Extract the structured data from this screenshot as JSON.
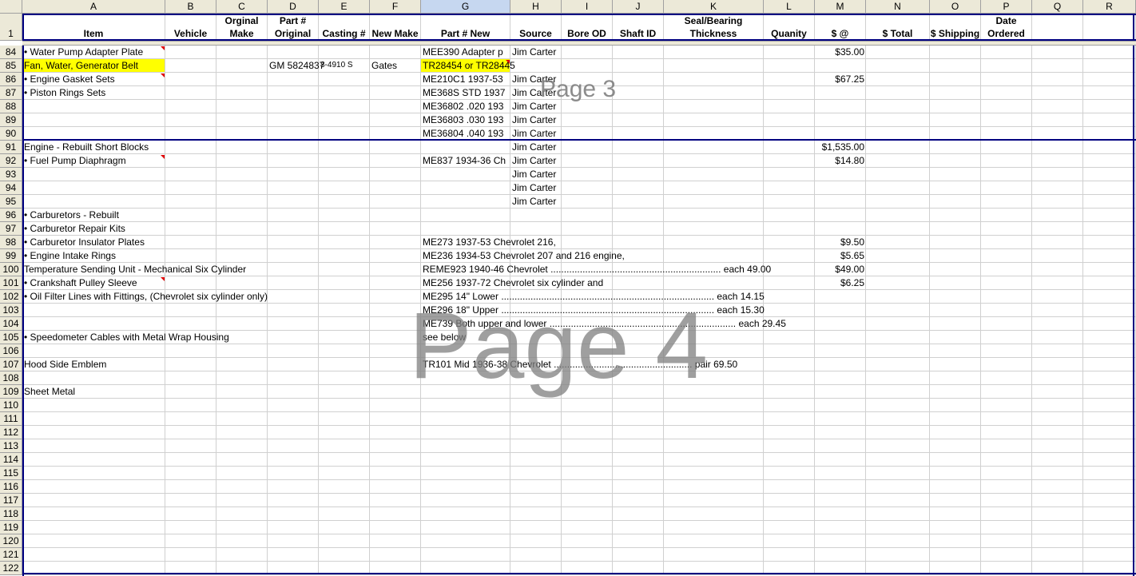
{
  "columns": [
    "A",
    "B",
    "C",
    "D",
    "E",
    "F",
    "G",
    "H",
    "I",
    "J",
    "K",
    "L",
    "M",
    "N",
    "O",
    "P",
    "Q",
    "R"
  ],
  "selected_column": "G",
  "header_row_number": "1",
  "headers": {
    "A": "Item",
    "B": "Vehicle",
    "C": "Orginal Make",
    "D": "Part # Original",
    "E": "Casting #",
    "F": "New Make",
    "G": "Part # New",
    "H": "Source",
    "I": "Bore OD",
    "J": "Shaft ID",
    "K": "Seal/Bearing Thickness",
    "L": "Quanity",
    "M": "$ @",
    "N": "$ Total",
    "O": "$ Shipping",
    "P": "Date Ordered"
  },
  "rows": [
    {
      "n": "84",
      "A": "• Water Pump Adapter Plate",
      "G": "MEE390 Adapter p",
      "H": "Jim Carter",
      "M": "$35.00"
    },
    {
      "n": "85",
      "A": "Fan, Water, Generator Belt",
      "D": "GM 5824837",
      "E": "8-4910 S",
      "F": "Gates",
      "G": "TR28454 or TR28445"
    },
    {
      "n": "86",
      "A": "• Engine Gasket Sets",
      "G": "ME210C1 1937-53",
      "H": "Jim Carter",
      "M": "$67.25"
    },
    {
      "n": "87",
      "A": "• Piston Rings Sets",
      "G": "ME368S STD 1937",
      "H": "Jim Carter"
    },
    {
      "n": "88",
      "G": "ME36802 .020 193",
      "H": "Jim Carter"
    },
    {
      "n": "89",
      "G": "ME36803 .030 193",
      "H": "Jim Carter"
    },
    {
      "n": "90",
      "G": "ME36804 .040 193",
      "H": "Jim Carter"
    },
    {
      "n": "91",
      "A": "Engine - Rebuilt Short Blocks",
      "H": "Jim Carter",
      "M": "$1,535.00"
    },
    {
      "n": "92",
      "A": "• Fuel Pump Diaphragm",
      "G": "ME837 1934-36 Ch",
      "H": "Jim Carter",
      "M": "$14.80"
    },
    {
      "n": "93",
      "H": "Jim Carter"
    },
    {
      "n": "94",
      "H": "Jim Carter"
    },
    {
      "n": "95",
      "H": "Jim Carter"
    },
    {
      "n": "96",
      "A": "• Carburetors - Rebuilt"
    },
    {
      "n": "97",
      "A": "• Carburetor Repair Kits"
    },
    {
      "n": "98",
      "A": "• Carburetor Insulator Plates",
      "G": "ME273 1937-53 Chevrolet 216,",
      "M": "$9.50"
    },
    {
      "n": "99",
      "A": "• Engine Intake Rings",
      "G": "ME236 1934-53 Chevrolet 207 and 216 engine,",
      "M": "$5.65"
    },
    {
      "n": "100",
      "A": "Temperature Sending Unit - Mechanical Six Cylinder",
      "G": "REME923 1940-46 Chevrolet ................................................................ each 49.00",
      "M": "$49.00"
    },
    {
      "n": "101",
      "A": "• Crankshaft Pulley Sleeve",
      "G": "ME256 1937-72 Chevrolet six cylinder and",
      "M": "$6.25"
    },
    {
      "n": "102",
      "A": "• Oil Filter Lines with Fittings, (Chevrolet six cylinder only)",
      "G": "ME295 14\" Lower ................................................................................ each 14.15"
    },
    {
      "n": "103",
      "G": "ME296 18\" Upper ................................................................................ each 15.30"
    },
    {
      "n": "104",
      "G": "ME739 Both upper and lower ...................................................................... each 29.45"
    },
    {
      "n": "105",
      "A": "• Speedometer Cables with Metal Wrap Housing",
      "G": "see below"
    },
    {
      "n": "106"
    },
    {
      "n": "107",
      "A": "Hood Side Emblem",
      "G": "TR101 Mid 1936-38 Chevrolet .................................................... pair 69.50"
    },
    {
      "n": "108"
    },
    {
      "n": "109",
      "A": "Sheet Metal"
    },
    {
      "n": "110"
    },
    {
      "n": "111"
    },
    {
      "n": "112"
    },
    {
      "n": "113"
    },
    {
      "n": "114"
    },
    {
      "n": "115"
    },
    {
      "n": "116"
    },
    {
      "n": "117"
    },
    {
      "n": "118"
    },
    {
      "n": "119"
    },
    {
      "n": "120"
    },
    {
      "n": "121"
    },
    {
      "n": "122"
    }
  ],
  "yellow_cells": [
    "85:A",
    "85:G"
  ],
  "comment_cells": [
    "84:A",
    "85:G",
    "86:A",
    "92:A",
    "101:A"
  ],
  "watermarks": {
    "page3": "Page 3",
    "page4": "Page 4"
  },
  "colors": {
    "header_bg": "#ece9d8",
    "selected_header_bg": "#c6d7f0",
    "highlight": "#ffff00",
    "page_break": "#000080",
    "watermark": "#808080",
    "comment": "#e00000"
  }
}
